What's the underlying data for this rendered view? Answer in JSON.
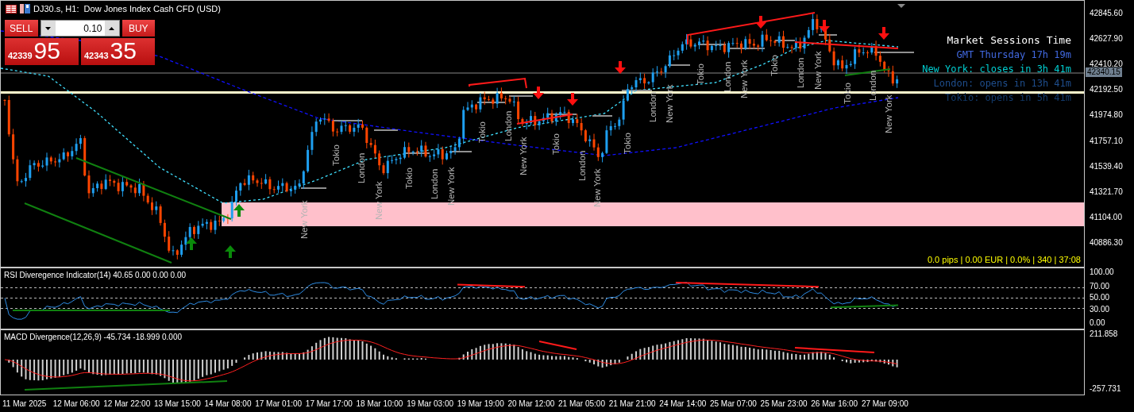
{
  "symbol_bar": {
    "title": "DJ30.s, H1:  Dow Jones Index Cash CFD (USD)"
  },
  "trade_panel": {
    "sell_label": "SELL",
    "buy_label": "BUY",
    "volume": "0.10",
    "sell_price_main": "42339",
    "sell_price_big": "95",
    "buy_price_main": "42343",
    "buy_price_big": "35"
  },
  "session_labels": [
    "New York",
    "Tokio",
    "London",
    "New York",
    "Tokio",
    "London",
    "New York",
    "Tokio",
    "London",
    "New York",
    "Tokio",
    "London",
    "New York",
    "Tokio",
    "London",
    "New York",
    "Tokio",
    "London",
    "New York",
    "Tokio",
    "London",
    "New York",
    "Tokio",
    "London",
    "New York"
  ],
  "market_sessions": {
    "title": "Market Sessions Time",
    "lines": [
      {
        "text": "GMT Thursday 17h 19m",
        "color": "#4169e1"
      },
      {
        "text": "New York: closes in 3h 41m",
        "color": "#00ced1"
      },
      {
        "text": "London: opens in 13h 41m",
        "color": "#1e4d8c"
      },
      {
        "text": "Tokio: opens in 5h 41m",
        "color": "#123a6b"
      }
    ]
  },
  "status_text": "0.0 pips | 0.00 EUR | 0.0% | 340 | 37:08",
  "price_axis": {
    "ticks": [
      "42845.60",
      "42627.90",
      "42410.20",
      "42192.50",
      "41974.80",
      "41757.10",
      "41539.40",
      "41321.70",
      "41104.00",
      "40886.30"
    ],
    "current_price": "42340.15"
  },
  "rsi": {
    "label": "RSI Diveregence Indicator(14) 40.65 0.00 0.00 0.00",
    "ticks": [
      "100.00",
      "70.00",
      "50.00",
      "30.00",
      "0.00"
    ]
  },
  "macd": {
    "label": "MACD Divergence(12,26,9) -45.734 -18.999 0.000",
    "ticks": [
      "211.858",
      "-257.731"
    ]
  },
  "time_axis": [
    "11 Mar 2025",
    "12 Mar 06:00",
    "12 Mar 22:00",
    "13 Mar 15:00",
    "14 Mar 08:00",
    "17 Mar 01:00",
    "17 Mar 17:00",
    "18 Mar 10:00",
    "19 Mar 03:00",
    "19 Mar 19:00",
    "20 Mar 12:00",
    "21 Mar 05:00",
    "21 Mar 21:00",
    "24 Mar 14:00",
    "25 Mar 07:00",
    "25 Mar 23:00",
    "26 Mar 16:00",
    "27 Mar 09:00"
  ]
}
